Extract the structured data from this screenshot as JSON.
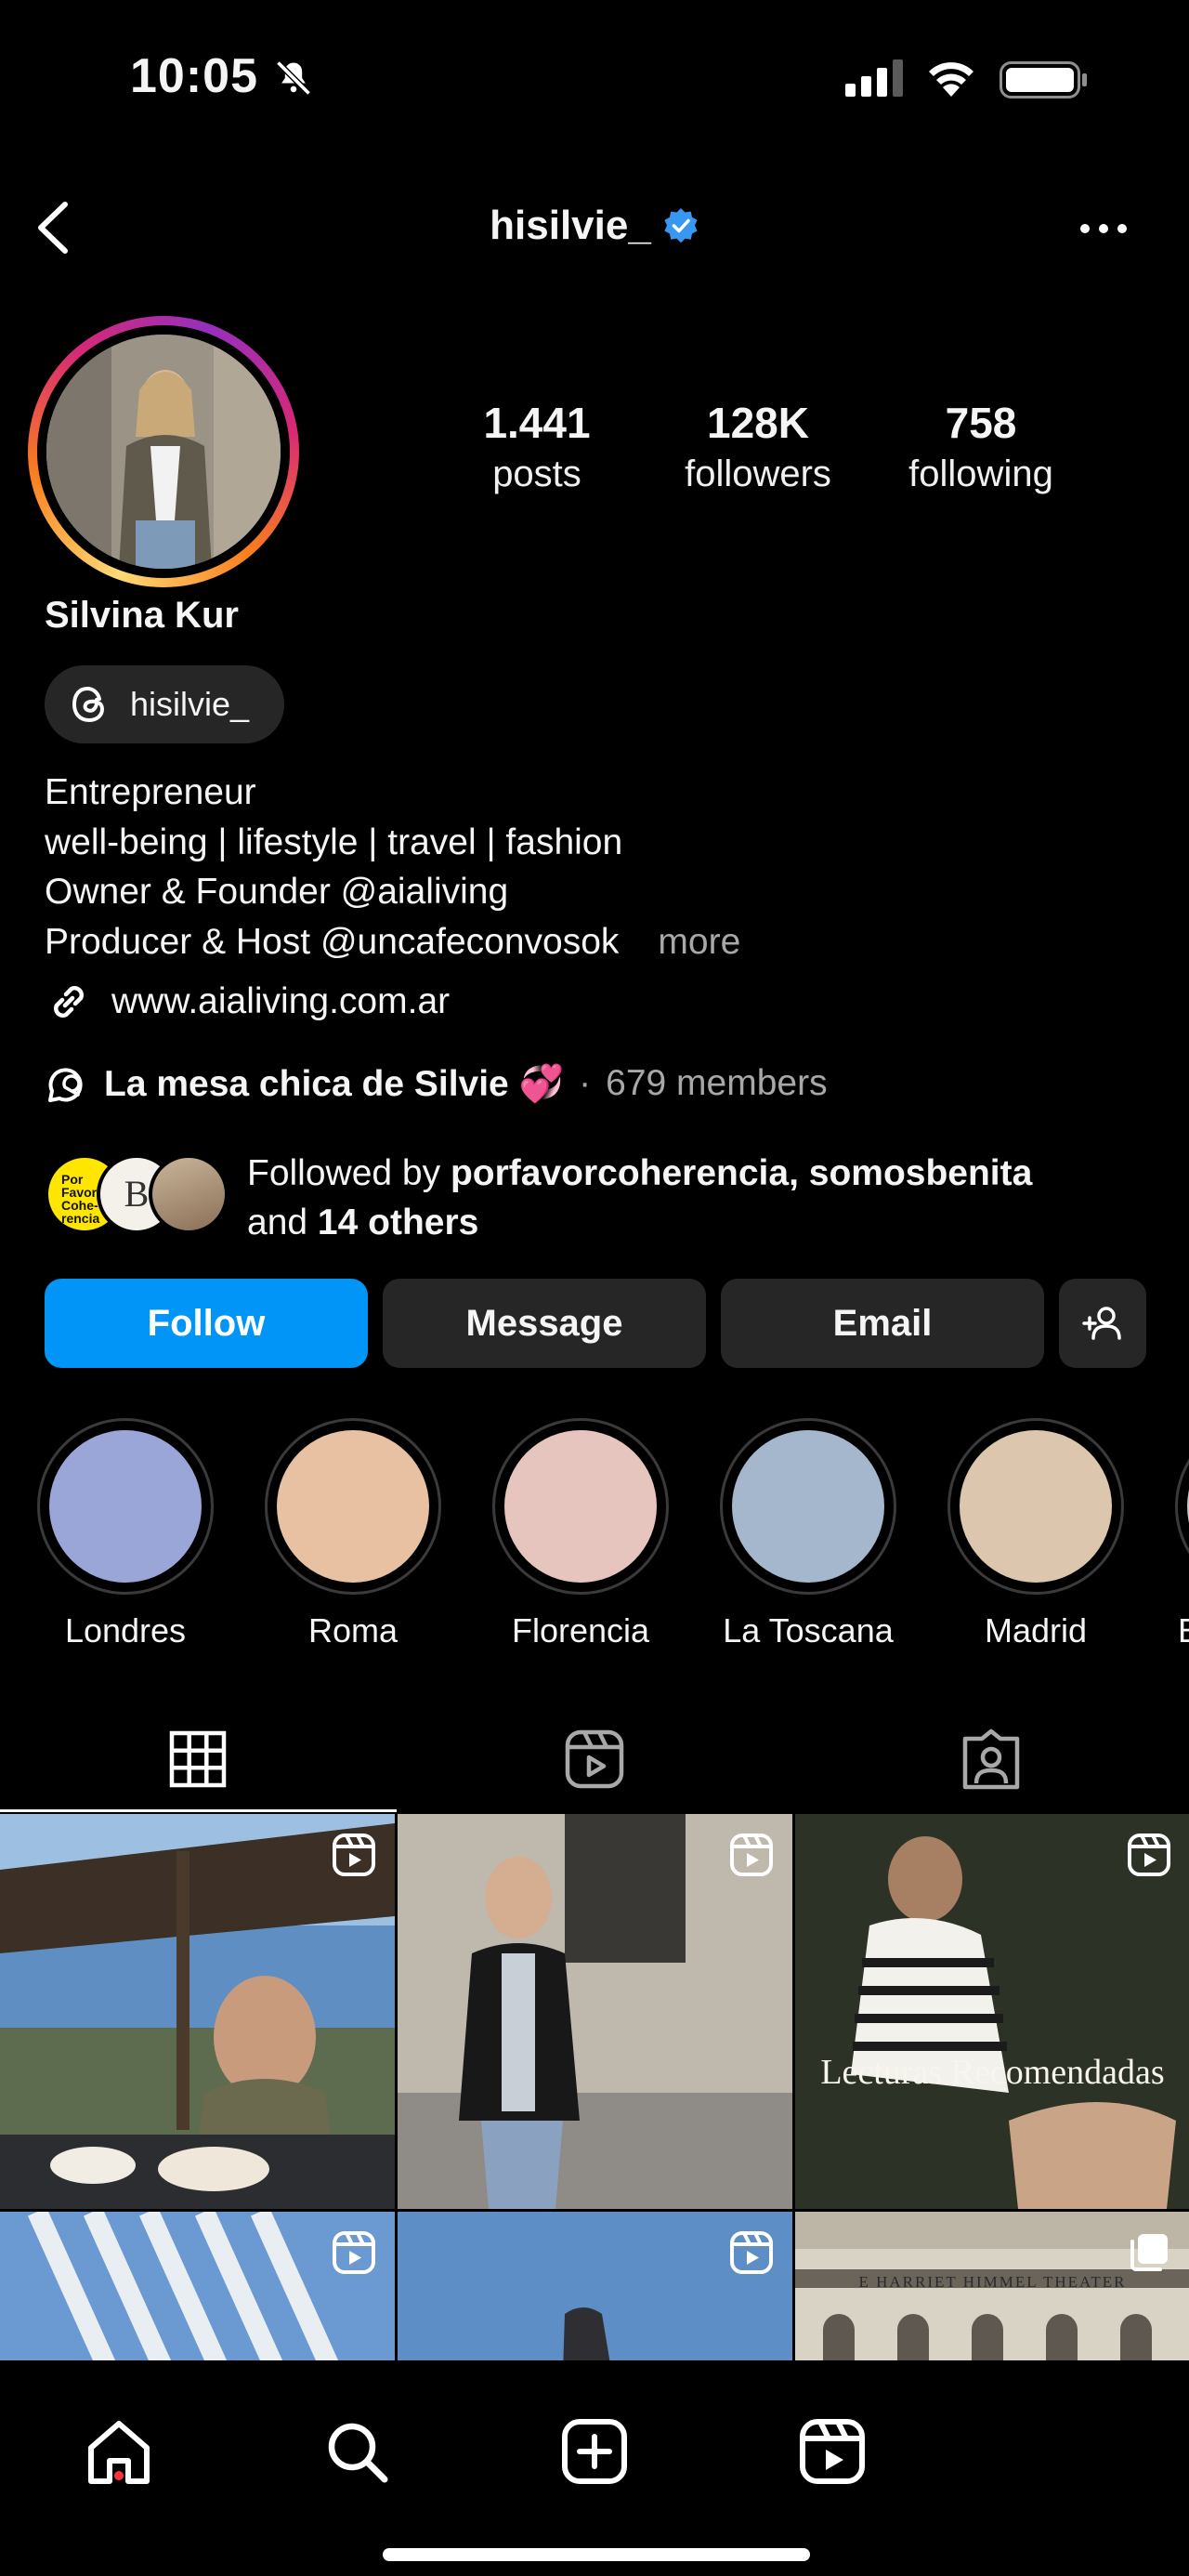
{
  "status_bar": {
    "time": "10:05"
  },
  "header": {
    "username": "hisilvie_"
  },
  "profile": {
    "display_name": "Silvina Kur",
    "threads_handle": "hisilvie_",
    "stats": [
      {
        "value": "1.441",
        "label": "posts"
      },
      {
        "value": "128K",
        "label": "followers"
      },
      {
        "value": "758",
        "label": "following"
      }
    ],
    "bio": [
      "Entrepreneur",
      "well-being | lifestyle | travel | fashion",
      "Owner & Founder @aialiving",
      "Producer & Host @uncafeconvosok"
    ],
    "bio_more": "more",
    "link": "www.aialiving.com.ar",
    "channel": {
      "name": "La mesa chica de Silvie 💞",
      "separator": "·",
      "members": "679 members"
    },
    "followed_by": {
      "prefix": "Followed by",
      "user1": "porfavorcoherencia",
      "comma": ",",
      "user2": "somosbenita",
      "and": "and",
      "others": "14 others"
    },
    "mutual_avatars": [
      {
        "text": "Por Favor Cohe- rencia"
      },
      {
        "text": "B"
      }
    ]
  },
  "actions": {
    "follow": "Follow",
    "message": "Message",
    "email": "Email"
  },
  "highlights": [
    {
      "label": "Londres",
      "color": "#9ba6d8"
    },
    {
      "label": "Roma",
      "color": "#e8c0a2"
    },
    {
      "label": "Florencia",
      "color": "#e5c5bd"
    },
    {
      "label": "La Toscana",
      "color": "#a5b7cc"
    },
    {
      "label": "Madrid",
      "color": "#dcc6ad"
    },
    {
      "label": "E",
      "color": "#c9c9c9"
    }
  ],
  "grid_posts": [
    {
      "caption": ""
    },
    {
      "caption": ""
    },
    {
      "caption": "Lecturas Recomendadas"
    },
    {
      "caption": ""
    },
    {
      "caption": ""
    },
    {
      "caption": "E HARRIET HIMMEL THEATER"
    }
  ],
  "colors": {
    "accent": "#0095f6",
    "verified": "#3897f0",
    "notification": "#ff3040"
  }
}
